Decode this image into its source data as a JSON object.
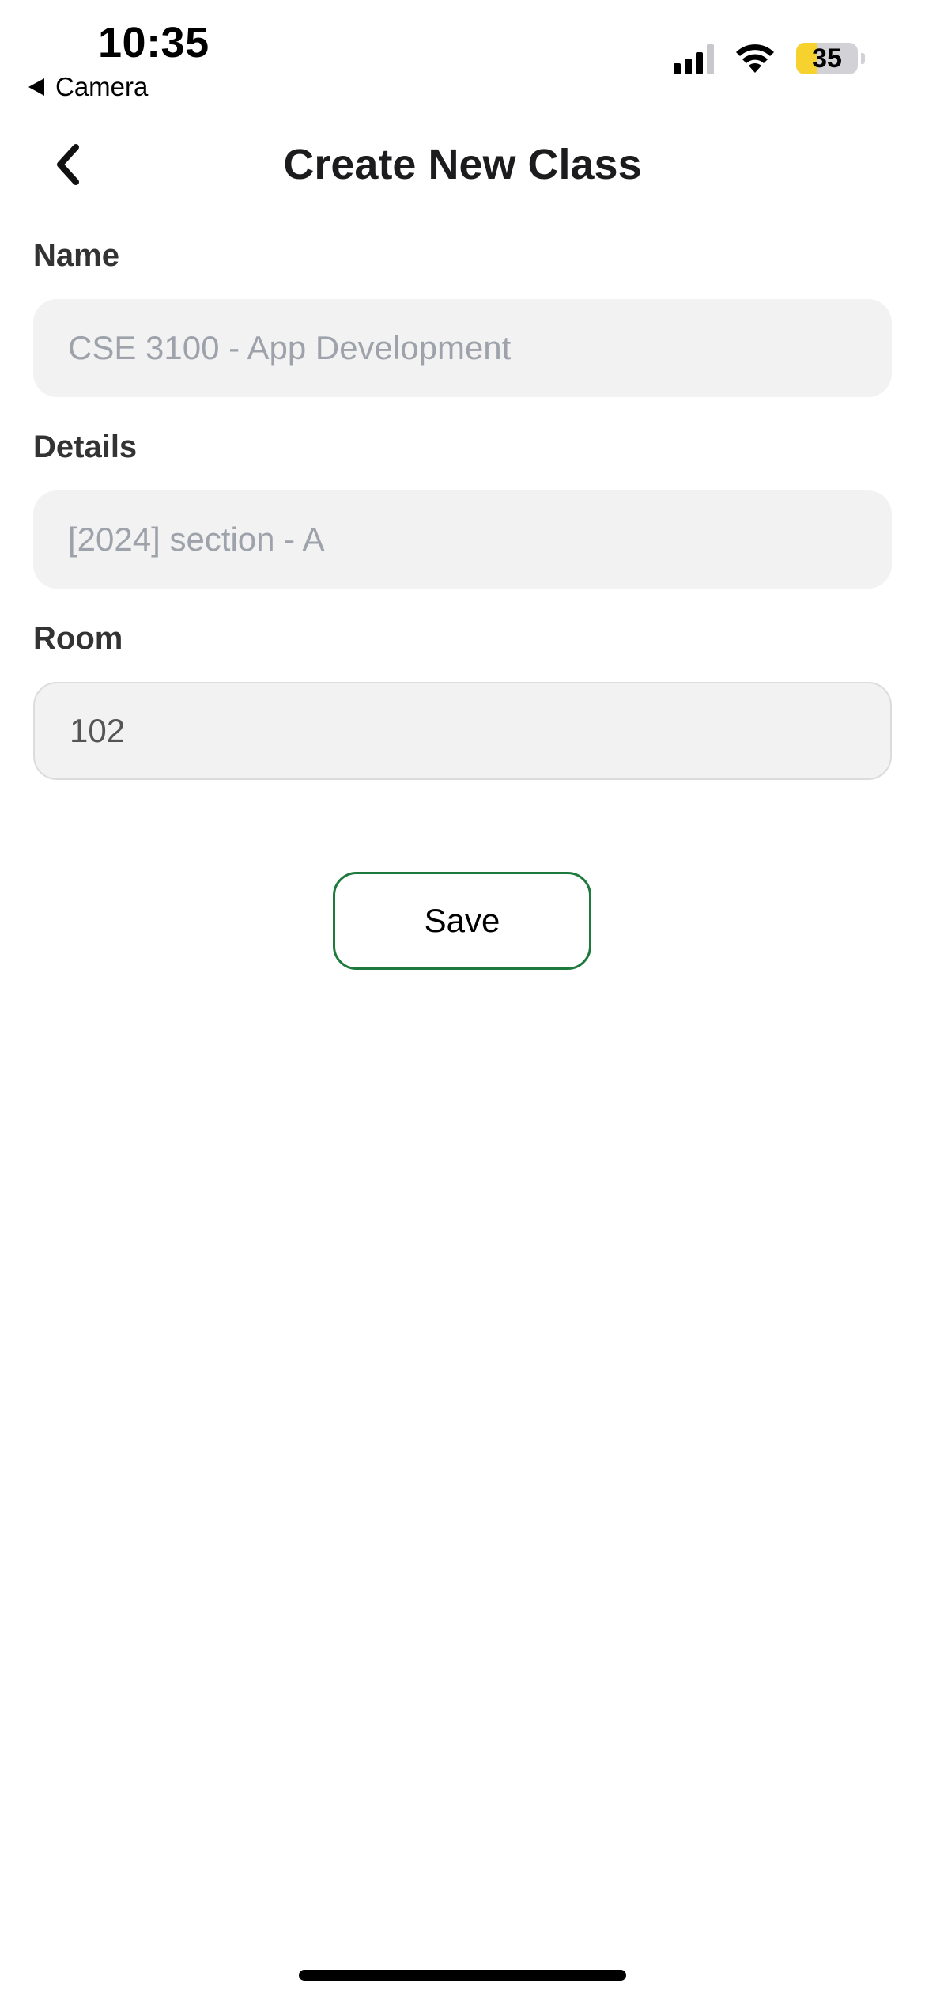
{
  "status_bar": {
    "time": "10:35",
    "back_app": "Camera",
    "battery_level": "35",
    "battery_fraction": 0.35
  },
  "header": {
    "title": "Create New Class"
  },
  "form": {
    "name": {
      "label": "Name",
      "placeholder": "CSE 3100 - App Development",
      "value": ""
    },
    "details": {
      "label": "Details",
      "placeholder": "[2024] section - A",
      "value": ""
    },
    "room": {
      "label": "Room",
      "placeholder": "",
      "value": "102"
    }
  },
  "actions": {
    "save_label": "Save"
  },
  "colors": {
    "accent_border": "#1e7a3c",
    "input_bg": "#f2f2f2",
    "battery_fill": "#f7d12d"
  }
}
